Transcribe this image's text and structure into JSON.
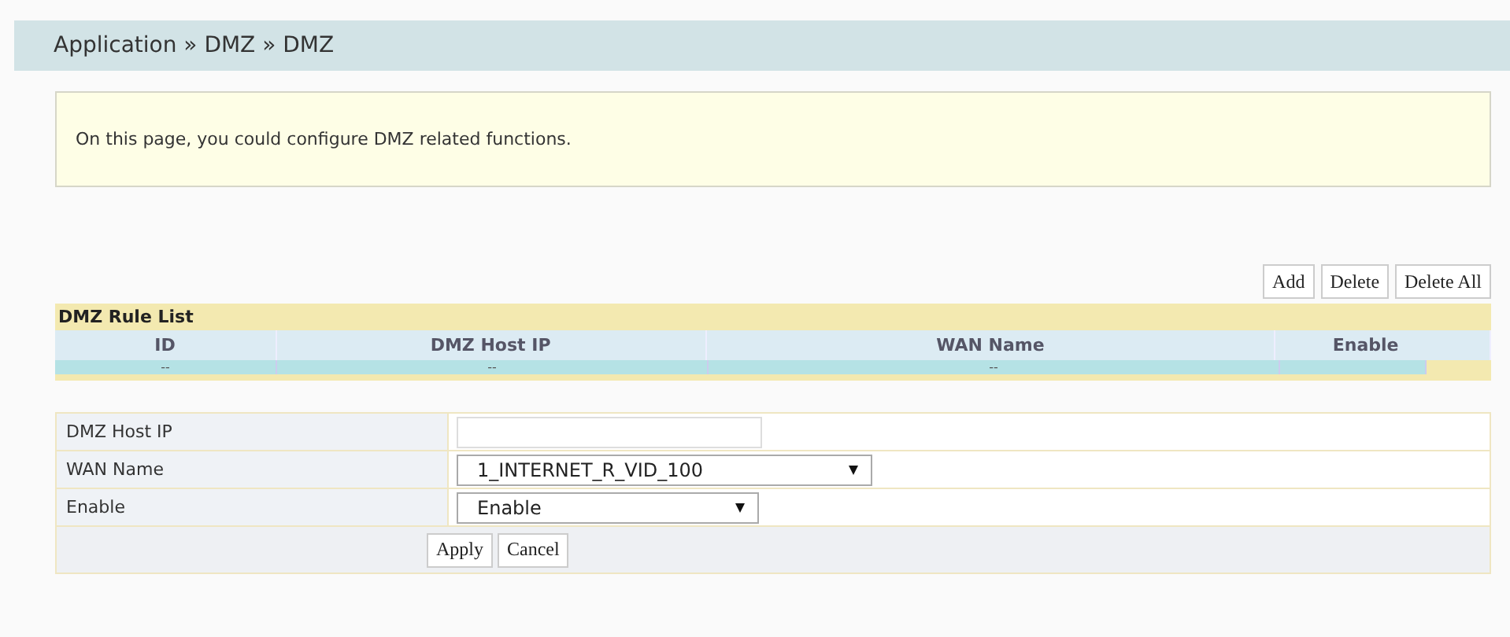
{
  "breadcrumb": "Application » DMZ » DMZ",
  "info": "On this page, you could configure DMZ related functions.",
  "list_buttons": [
    "Add",
    "Delete",
    "Delete All"
  ],
  "rule_list": {
    "title": "DMZ Rule List",
    "columns": [
      "ID",
      "DMZ Host IP",
      "WAN Name",
      "Enable"
    ],
    "rows": [
      {
        "cells": [
          "--",
          "--",
          "--"
        ]
      }
    ]
  },
  "form": {
    "fields": [
      {
        "label": "DMZ Host IP",
        "kind": "text"
      },
      {
        "label": "WAN Name",
        "kind": "select",
        "value": "1_INTERNET_R_VID_100"
      },
      {
        "label": "Enable",
        "kind": "select",
        "value": "Enable"
      }
    ],
    "buttons": [
      "Apply",
      "Cancel"
    ]
  }
}
